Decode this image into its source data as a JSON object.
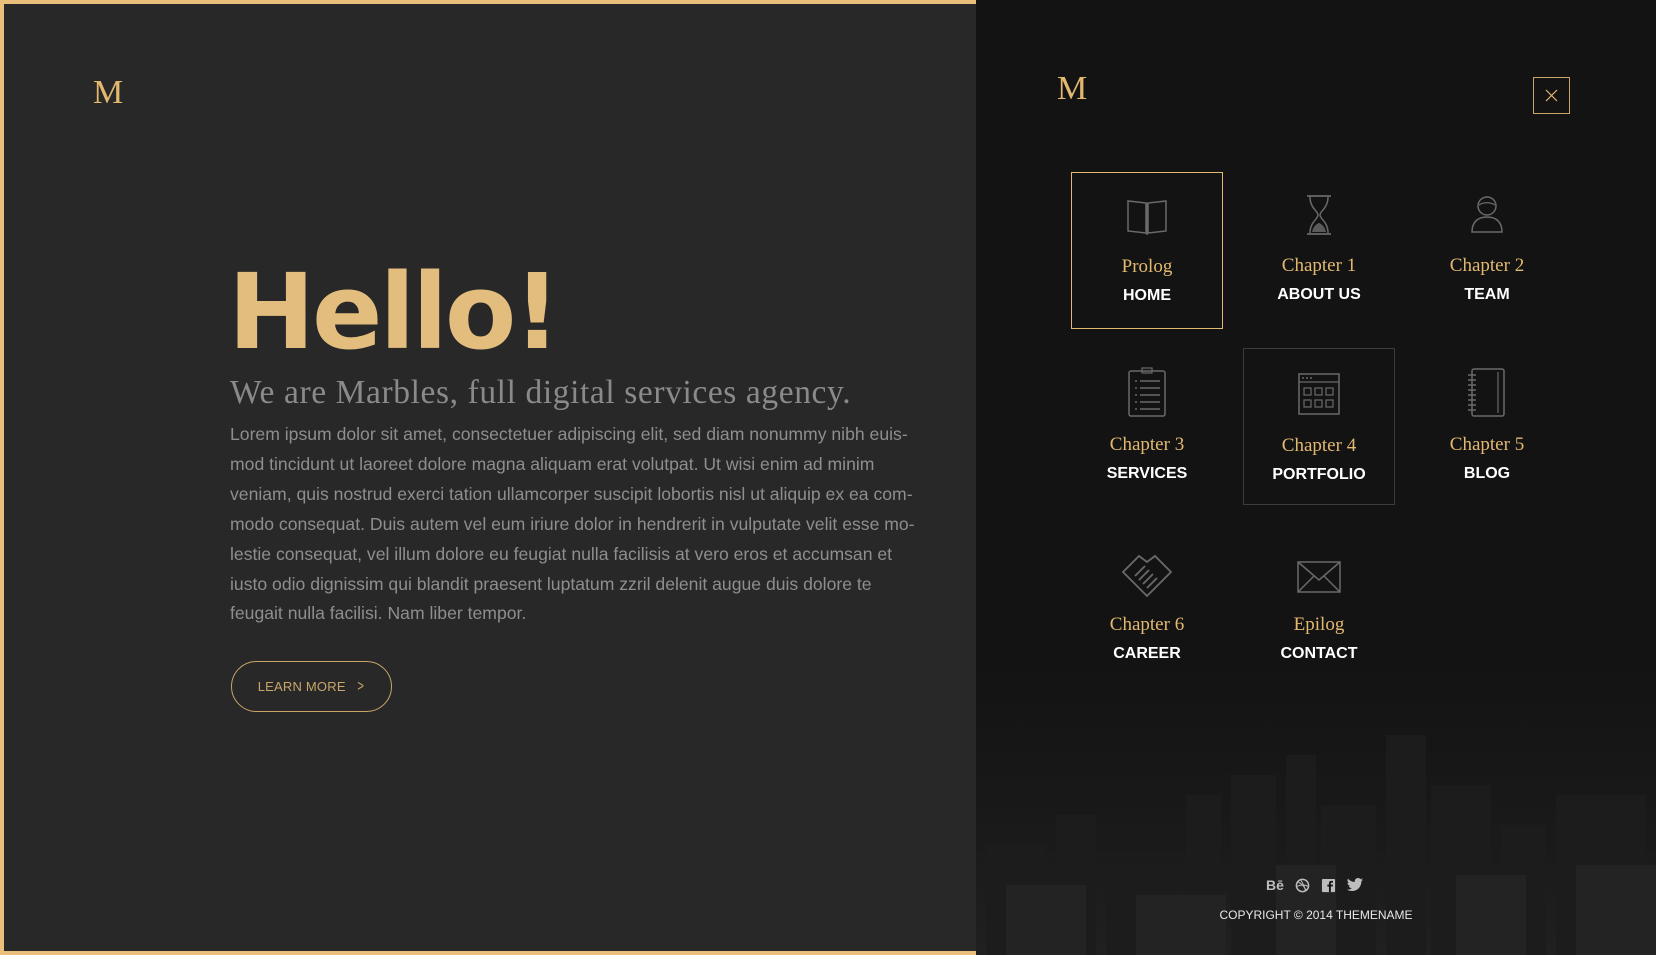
{
  "left": {
    "logo": "M",
    "hero_title": "Hello!",
    "hero_subtitle": "We are Marbles, full digital services agency.",
    "hero_body": "Lorem ipsum dolor sit amet, consectetuer adipiscing elit, sed diam nonummy nibh euis-mod tincidunt ut laoreet dolore magna aliquam erat volutpat. Ut wisi enim ad minim veniam, quis nostrud exerci tation ullamcorper suscipit lobortis nisl ut aliquip ex ea com-modo consequat. Duis autem vel eum iriure dolor in hendrerit in vulputate velit esse mo-lestie consequat, vel illum dolore eu feugiat nulla facilisis at vero eros et accumsan et iusto odio dignissim qui blandit praesent luptatum zzril delenit augue duis dolore te feugait nulla facilisi. Nam liber tempor.",
    "learn_more": "LEARN MORE"
  },
  "menu": {
    "logo": "M",
    "items": [
      {
        "chapter": "Prolog",
        "label": "HOME",
        "icon": "book-icon"
      },
      {
        "chapter": "Chapter 1",
        "label": "ABOUT US",
        "icon": "hourglass-icon"
      },
      {
        "chapter": "Chapter 2",
        "label": "TEAM",
        "icon": "person-icon"
      },
      {
        "chapter": "Chapter 3",
        "label": "SERVICES",
        "icon": "clipboard-icon"
      },
      {
        "chapter": "Chapter 4",
        "label": "PORTFOLIO",
        "icon": "grid-window-icon"
      },
      {
        "chapter": "Chapter 5",
        "label": "BLOG",
        "icon": "notebook-icon"
      },
      {
        "chapter": "Chapter 6",
        "label": "CAREER",
        "icon": "handshake-icon"
      },
      {
        "chapter": "Epilog",
        "label": "CONTACT",
        "icon": "envelope-icon"
      }
    ]
  },
  "social": {
    "behance": "Bē",
    "dribbble_icon": "dribbble-icon",
    "facebook_icon": "facebook-icon",
    "twitter_icon": "twitter-icon"
  },
  "footer": {
    "copyright": "COPYRIGHT © 2014 THEMENAME"
  },
  "colors": {
    "accent": "#e3b970",
    "border": "#e9bf7b",
    "left_bg": "#282828",
    "menu_bg": "#131313"
  }
}
